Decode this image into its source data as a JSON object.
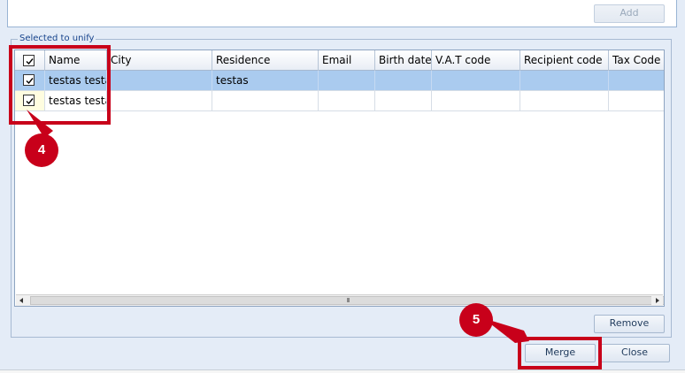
{
  "dialog": {
    "add_button": "Add",
    "group_title": "Selected to unify",
    "remove_button": "Remove",
    "merge_button": "Merge",
    "close_button": "Close"
  },
  "grid": {
    "columns": [
      "Name",
      "City",
      "Residence",
      "Email",
      "Birth date",
      "V.A.T code",
      "Recipient code",
      "Tax Code"
    ],
    "rows": [
      {
        "checked": true,
        "selected": true,
        "name": "testas testas",
        "city": "",
        "residence": "testas",
        "email": "",
        "birth_date": "",
        "vat_code": "",
        "recipient_code": "",
        "tax_code": ""
      },
      {
        "checked": true,
        "selected": false,
        "name": "testas testas",
        "city": "",
        "residence": "",
        "email": "",
        "birth_date": "",
        "vat_code": "",
        "recipient_code": "",
        "tax_code": ""
      }
    ],
    "scroll_grip": "III"
  },
  "callouts": {
    "step_4": "4",
    "step_5": "5",
    "color": "#c8001a"
  }
}
